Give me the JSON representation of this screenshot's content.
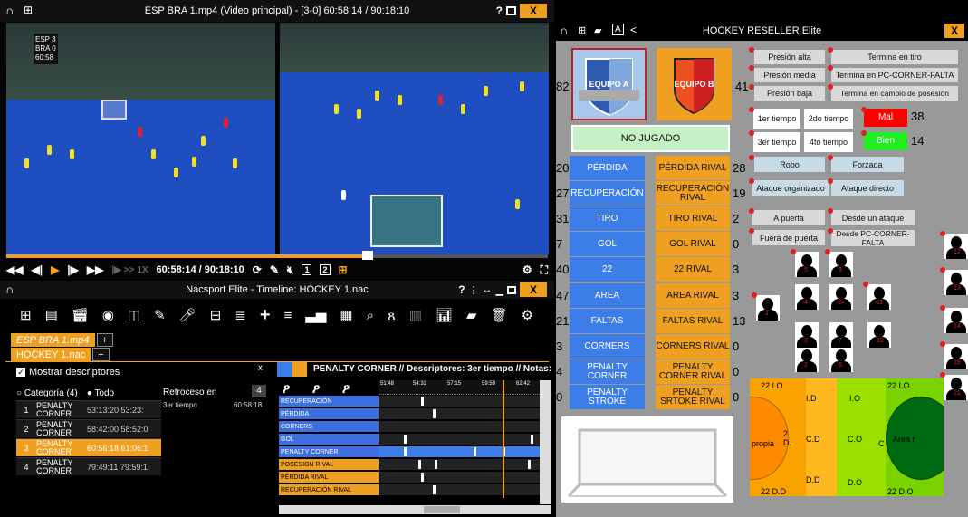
{
  "video": {
    "title": "ESP BRA 1.mp4 (Video principal)  -  [3-0] 60:58:14 / 90:18:10",
    "help": "?",
    "close": "X",
    "score": [
      "ESP 3",
      "BRA 0",
      "60:58"
    ],
    "speed": "1X",
    "timecode": "60:58:14 / 90:18:10",
    "cam1": "1",
    "cam2": "2",
    "progress": 0.67
  },
  "timeline": {
    "title": "Nacsport Elite - Timeline: HOCKEY 1.nac",
    "help": "?",
    "close": "X",
    "tabs_top": [
      "ESP BRA 1.mp4",
      "+"
    ],
    "tabs_bottom": [
      "HOCKEY 1.nac",
      "+"
    ],
    "show_desc_label": "Mostrar descriptores",
    "close_panel": "x",
    "filter_category": "Categoría (4)",
    "filter_all": "Todo",
    "retroceso_label": "Retroceso en",
    "retroceso_value": "4",
    "retroceso_item": "3er tiempo",
    "retroceso_time": "60:58:18",
    "categories": [
      {
        "n": "1",
        "name": "PENALTY CORNER",
        "t": "53:13:20 53:23:"
      },
      {
        "n": "2",
        "name": "PENALTY CORNER",
        "t": "58:42:00 58:52:0"
      },
      {
        "n": "3",
        "name": "PENALTY CORNER",
        "t": "60:56:18 61:06:1"
      },
      {
        "n": "4",
        "name": "PENALTY CORNER",
        "t": "79:49:11 79:59:1"
      }
    ],
    "header_title": "PENALTY CORNER // Descriptores: 3er tiempo // Notas:",
    "ticks": [
      "51:48",
      "54:32",
      "57:15",
      "59:59",
      "62:42"
    ],
    "rows": [
      {
        "label": "RECUPERACIÓN",
        "color": "blue"
      },
      {
        "label": "PÉRDIDA",
        "color": "blue"
      },
      {
        "label": "CORNERS",
        "color": "blue"
      },
      {
        "label": "GOL",
        "color": "blue"
      },
      {
        "label": "PENALTY CORNER",
        "color": "blue"
      },
      {
        "label": "POSESION RIVAL",
        "color": "orange"
      },
      {
        "label": "PÉRDIDA RIVAL",
        "color": "orange"
      },
      {
        "label": "RECUPERACIÓN RIVAL",
        "color": "orange"
      }
    ]
  },
  "panel": {
    "title": "HOCKEY RESELLER Elite",
    "close": "X",
    "team_a": "EQUIPO A",
    "team_b": "EQUIPO B",
    "score_a": "82",
    "score_b": "41",
    "no_jugado": "NO JUGADO",
    "tactics": [
      "Presión alta",
      "Presión media",
      "Presión baja"
    ],
    "endings": [
      "Termina en tiro",
      "Termina en PC-CORNER-FALTA",
      "Termina en cambio de posesión"
    ],
    "periods": [
      "1er tiempo",
      "2do tiempo",
      "3er tiempo",
      "4to tiempo"
    ],
    "mal_label": "Mal",
    "mal_count": "38",
    "bien_label": "Bien",
    "bien_count": "14",
    "own_buttons": [
      {
        "label": "PÉRDIDA",
        "count": "20"
      },
      {
        "label": "RECUPERACIÓN",
        "count": "27"
      },
      {
        "label": "TIRO",
        "count": "31"
      },
      {
        "label": "GOL",
        "count": "7"
      },
      {
        "label": "22",
        "count": "40"
      },
      {
        "label": "AREA",
        "count": "47"
      },
      {
        "label": "FALTAS",
        "count": "21"
      },
      {
        "label": "CORNERS",
        "count": "3"
      },
      {
        "label": "PENALTY CORNER",
        "count": "4"
      },
      {
        "label": "PENALTY STROKE",
        "count": "0"
      }
    ],
    "rival_buttons": [
      {
        "label": "PÉRDIDA RIVAL",
        "count": "28"
      },
      {
        "label": "RECUPERACIÓN RIVAL",
        "count": "19"
      },
      {
        "label": "TIRO RIVAL",
        "count": "2"
      },
      {
        "label": "GOL RIVAL",
        "count": "0"
      },
      {
        "label": "22 RIVAL",
        "count": "3"
      },
      {
        "label": "AREA RIVAL",
        "count": "3"
      },
      {
        "label": "FALTAS RIVAL",
        "count": "13"
      },
      {
        "label": "CORNERS RIVAL",
        "count": "0"
      },
      {
        "label": "PENALTY CORNER RIVAL",
        "count": "0"
      },
      {
        "label": "PENALTY SRTOKE RIVAL",
        "count": "0"
      }
    ],
    "options": [
      "Robo",
      "Forzada",
      "Ataque organizado",
      "Ataque directo",
      "A puerta",
      "Desde un ataque",
      "Fuera de puerta",
      "Desde PC-CORNER-FALTA"
    ],
    "players": [
      "1",
      "2",
      "3",
      "4",
      "5",
      "6",
      "7",
      "8",
      "9",
      "10",
      "11",
      "12",
      "13",
      "14",
      "19",
      "21"
    ],
    "field": {
      "left_top": "22 I.O",
      "left_bottom": "22 D.D",
      "right_top": "22 I.O",
      "right_bottom": "22 D.O",
      "propia": "propia",
      "area_r": "Area r",
      "z2d": "2 D.",
      "id": "I.D",
      "cd": "C.D",
      "dd": "D.D",
      "io": "I.O",
      "co": "C.O",
      "do": "D.O",
      "c": "C"
    }
  }
}
